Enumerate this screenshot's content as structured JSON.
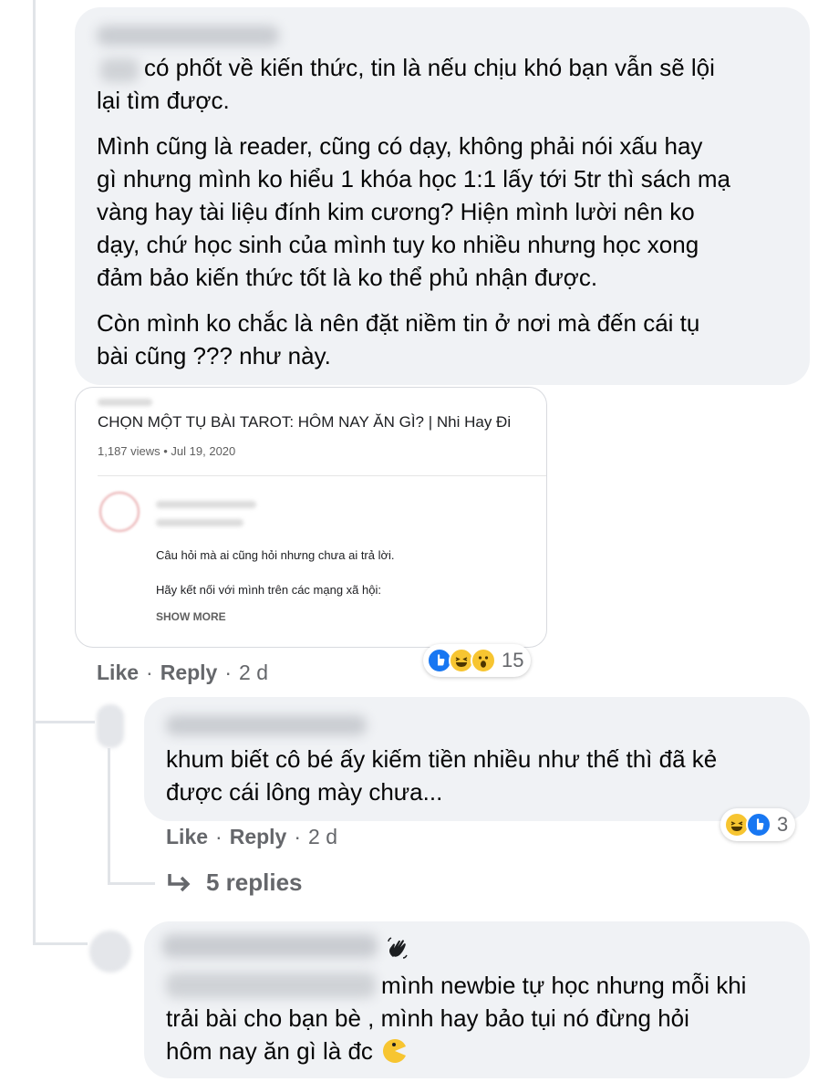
{
  "comment1": {
    "paragraphs": [
      "có phốt về kiến thức, tin là nếu chịu khó bạn vẫn sẽ lội lại tìm được.",
      "Mình cũng là reader, cũng có dạy, không phải nói xấu hay gì nhưng mình ko hiểu 1 khóa học 1:1 lấy tới 5tr thì sách mạ vàng hay tài liệu đính kim cương? Hiện mình lười nên ko dạy, chứ học sinh của mình tuy ko nhiều nhưng học xong đảm bảo kiến thức tốt là ko thể phủ nhận được.",
      "Còn mình ko chắc là nên đặt niềm tin ở nơi mà đến cái tụ bài cũng ??? như này."
    ],
    "line_breaks": [
      [
        "có phốt về kiến thức, tin là nếu chịu khó bạn vẫn sẽ lội",
        "lại tìm được."
      ],
      [
        "Mình cũng là reader, cũng có dạy, không phải nói xấu hay",
        "gì nhưng mình ko hiểu 1 khóa học 1:1 lấy tới 5tr thì sách mạ",
        "vàng hay tài liệu đính kim cương? Hiện mình lười nên ko",
        "dạy, chứ học sinh của mình tuy ko nhiều nhưng học xong",
        "đảm bảo kiến thức tốt là ko thể phủ nhận được."
      ],
      [
        "Còn mình ko chắc là nên đặt niềm tin ở nơi mà đến cái tụ",
        "bài cũng ??? như này."
      ]
    ],
    "card": {
      "title": "CHỌN MỘT TỤ BÀI TAROT: HÔM NAY ĂN GÌ? | Nhi Hay Đi",
      "views": "1,187 views • Jul 19, 2020",
      "desc_line1": "Câu hỏi mà ai cũng hỏi nhưng chưa ai trả lời.",
      "desc_line2": "Hãy kết nối với mình trên các mạng xã hội:",
      "show_more": "SHOW MORE"
    },
    "actions": {
      "like": "Like",
      "reply": "Reply",
      "time": "2 d"
    },
    "reactions": {
      "icons": [
        "like-icon",
        "haha-icon",
        "wow-icon"
      ],
      "count": "15"
    }
  },
  "comment2": {
    "lines": [
      "khum biết cô bé ấy kiếm tiền nhiều như thế thì đã kẻ",
      "được cái lông mày chưa..."
    ],
    "actions": {
      "like": "Like",
      "reply": "Reply",
      "time": "2 d"
    },
    "reactions": {
      "icons": [
        "haha-icon",
        "like-icon"
      ],
      "count": "3"
    },
    "replies_label": "5 replies"
  },
  "comment3": {
    "line1_visible": "mình newbie tự học nhưng mỗi khi",
    "line2": "trải bài cho bạn bè , mình hay bảo tụi nó đừng hỏi",
    "line3": "hôm nay ăn gì là đc"
  },
  "colors": {
    "bubble": "#f0f2f5",
    "meta_text": "#65676b",
    "like_blue": "#1877f2",
    "haha_yellow": "#f7c531"
  }
}
